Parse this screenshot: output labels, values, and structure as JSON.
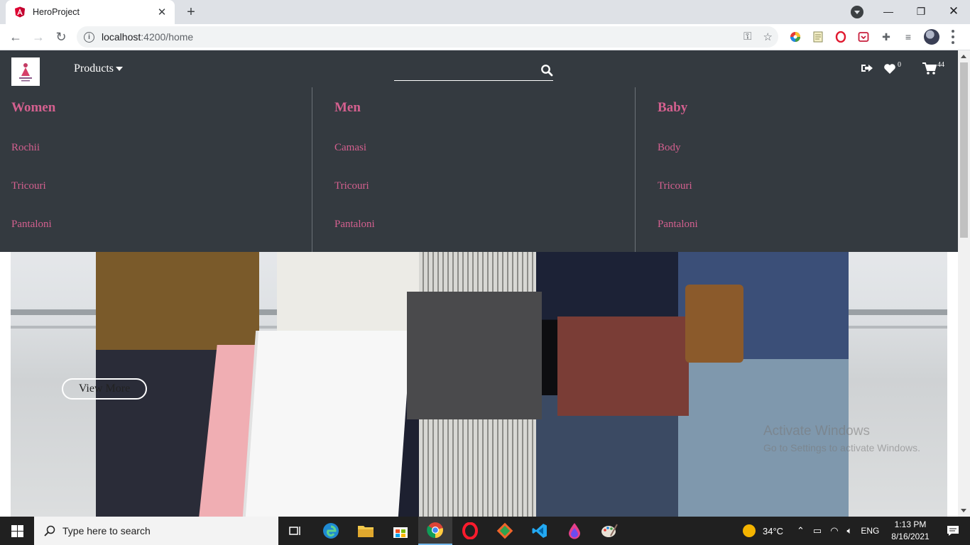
{
  "browser": {
    "tab_title": "HeroProject",
    "url_host": "localhost",
    "url_path": ":4200/home"
  },
  "app": {
    "nav": {
      "products_label": "Products",
      "search_placeholder": "",
      "wishlist_count": "0",
      "cart_count": "44"
    },
    "menu": {
      "columns": [
        {
          "title": "Women",
          "items": [
            "Rochii",
            "Tricouri",
            "Pantaloni"
          ]
        },
        {
          "title": "Men",
          "items": [
            "Camasi",
            "Tricouri",
            "Pantaloni"
          ]
        },
        {
          "title": "Baby",
          "items": [
            "Body",
            "Tricouri",
            "Pantaloni"
          ]
        }
      ]
    },
    "hero": {
      "button_label": "View More"
    },
    "watermark": {
      "title": "Activate Windows",
      "subtitle": "Go to Settings to activate Windows."
    }
  },
  "taskbar": {
    "search_placeholder": "Type here to search",
    "weather": "34°C",
    "language": "ENG",
    "time": "1:13 PM",
    "date": "8/16/2021"
  },
  "colors": {
    "navbar": "#343a40",
    "menu_link": "#d4608f",
    "taskbar": "#202020"
  }
}
